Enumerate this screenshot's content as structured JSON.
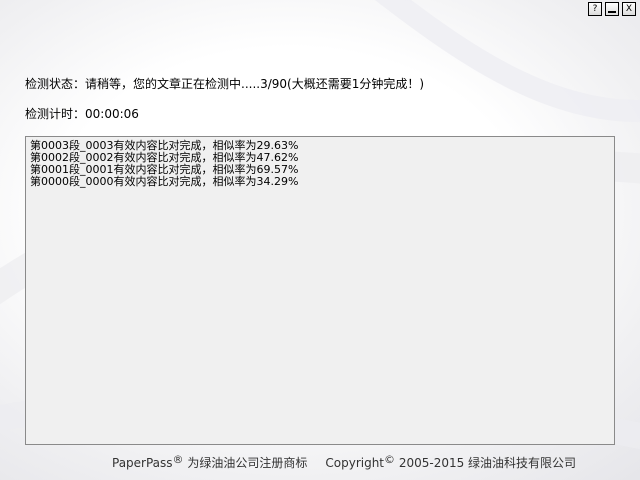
{
  "window_controls": {
    "help_label": "?",
    "close_label": "X"
  },
  "status": {
    "label": "检测状态：",
    "message": "请稍等，您的文章正在检测中.....3/90(大概还需要1分钟完成！)"
  },
  "timer": {
    "label": "检测计时：",
    "value": "00:00:06"
  },
  "log": {
    "lines": [
      "第0003段_0003有效内容比对完成，相似率为29.63%",
      "第0002段_0002有效内容比对完成，相似率为47.62%",
      "第0001段_0001有效内容比对完成，相似率为69.57%",
      "第0000段_0000有效内容比对完成，相似率为34.29%"
    ]
  },
  "footer": {
    "brand": "PaperPass",
    "registered_mark": "®",
    "trademark_text": " 为绿油油公司注册商标",
    "copyright_word": "Copyright",
    "copyright_mark": "©",
    "copyright_text": " 2005-2015 绿油油科技有限公司"
  }
}
